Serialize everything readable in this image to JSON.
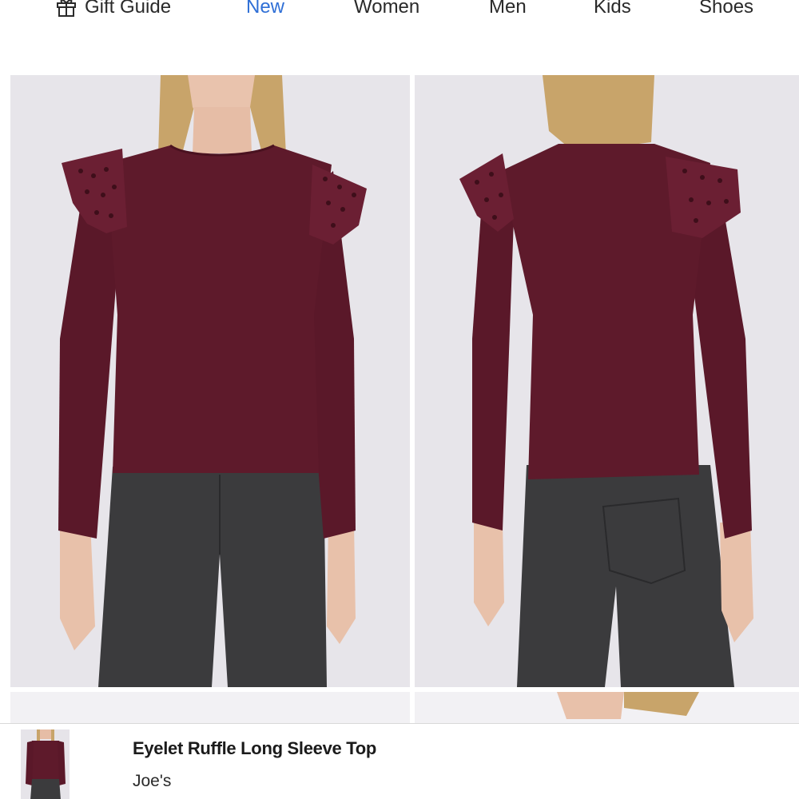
{
  "nav": {
    "items": [
      {
        "label": "Gift Guide",
        "icon": "gift-icon",
        "active": false
      },
      {
        "label": "New",
        "active": true
      },
      {
        "label": "Women",
        "active": false
      },
      {
        "label": "Men",
        "active": false
      },
      {
        "label": "Kids",
        "active": false
      },
      {
        "label": "Shoes",
        "active": false
      }
    ],
    "active_color": "#2f6fd6"
  },
  "gallery": {
    "images": [
      {
        "view": "front",
        "shirt_color": "#5e1a2b",
        "jeans_color": "#3b3b3d"
      },
      {
        "view": "back",
        "shirt_color": "#5e1a2b",
        "jeans_color": "#3b3b3d"
      }
    ]
  },
  "sticky_bar": {
    "product_name": "Eyelet Ruffle Long Sleeve Top",
    "brand": "Joe's"
  }
}
